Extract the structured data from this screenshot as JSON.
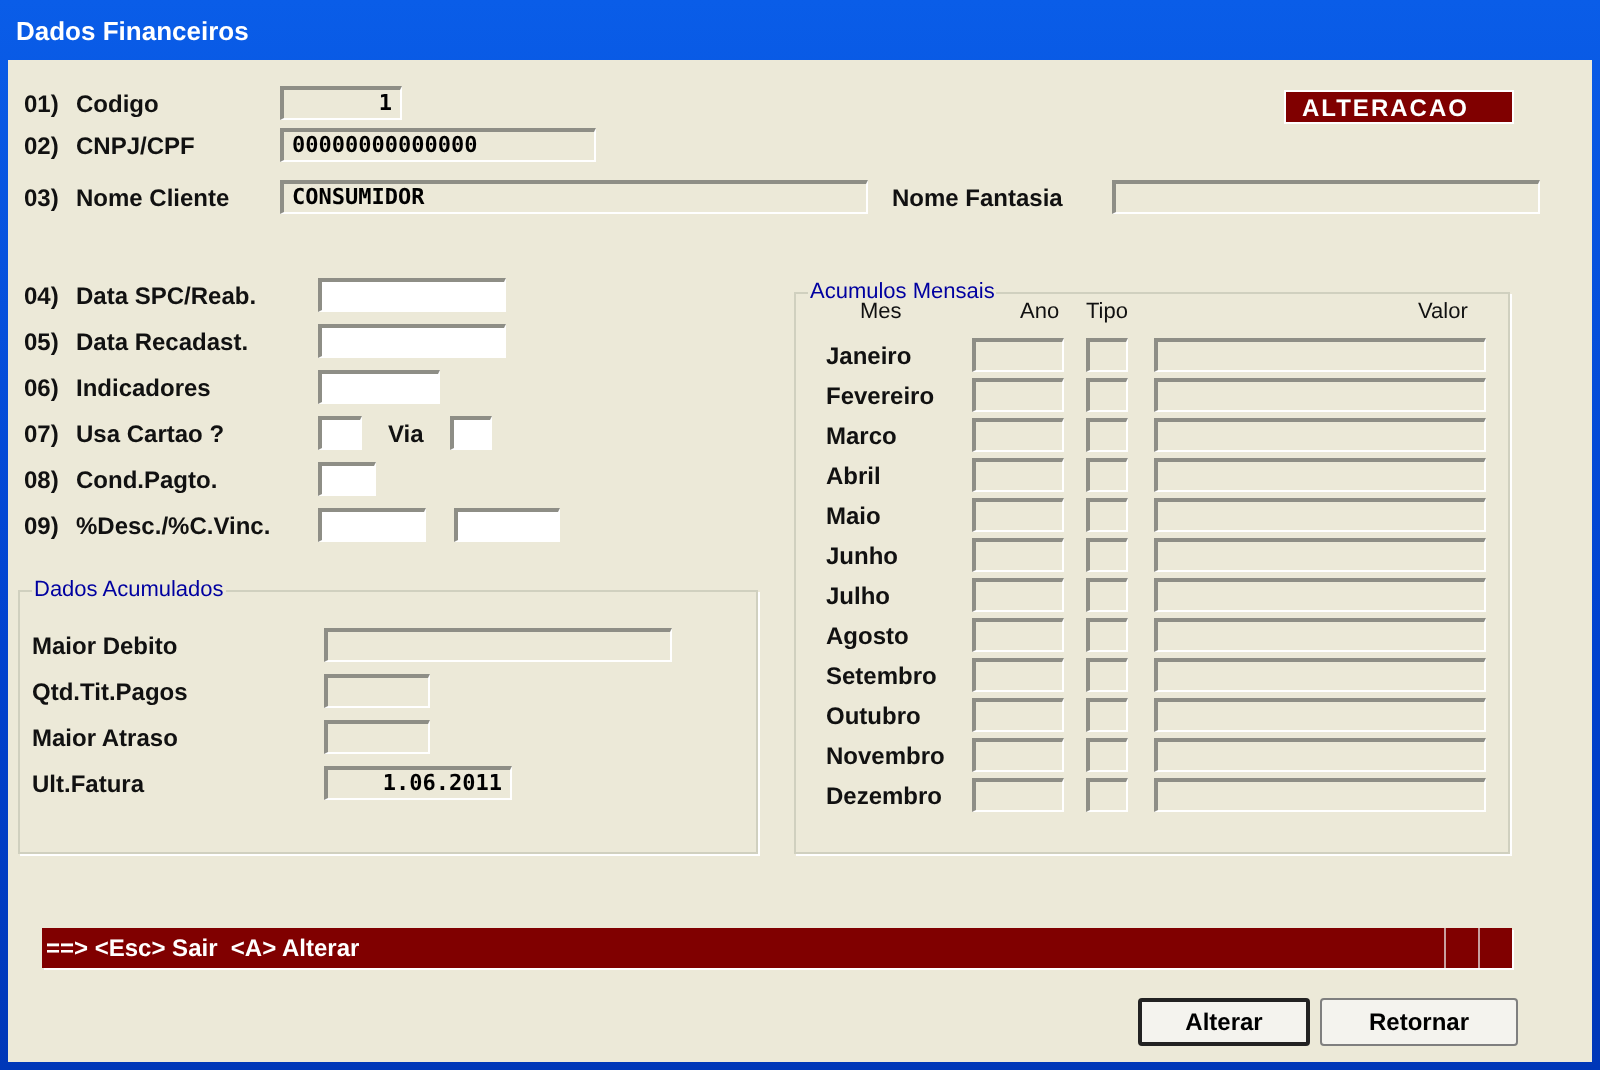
{
  "window": {
    "title": "Dados Financeiros"
  },
  "mode_badge": "ALTERACAO",
  "header_fields": [
    {
      "number": "01)",
      "label": "Codigo",
      "value": "1",
      "kind": "code"
    },
    {
      "number": "02)",
      "label": "CNPJ/CPF",
      "value": "00000000000000",
      "kind": "doc"
    },
    {
      "number": "03)",
      "label": "Nome Cliente",
      "value": "CONSUMIDOR",
      "kind": "name",
      "extra_label": "Nome Fantasia"
    }
  ],
  "form_rows": [
    {
      "number": "04)",
      "label": "Data SPC/Reab.",
      "kind": "date"
    },
    {
      "number": "05)",
      "label": "Data Recadast.",
      "kind": "date"
    },
    {
      "number": "06)",
      "label": "Indicadores",
      "kind": "medium"
    },
    {
      "number": "07)",
      "label": "Usa Cartao ?",
      "kind": "with_via",
      "extra_label": "Via"
    },
    {
      "number": "08)",
      "label": "Cond.Pagto.",
      "kind": "small"
    },
    {
      "number": "09)",
      "label": "%Desc./%C.Vinc.",
      "kind": "pair"
    }
  ],
  "dados_acumulados": {
    "title": "Dados Acumulados",
    "rows": [
      {
        "label": "Maior Debito",
        "kind": "wide"
      },
      {
        "label": "Qtd.Tit.Pagos",
        "kind": "short"
      },
      {
        "label": "Maior Atraso",
        "kind": "short"
      },
      {
        "label": "Ult.Fatura",
        "kind": "date",
        "value": "1.06.2011"
      }
    ]
  },
  "acumulos_mensais": {
    "title": "Acumulos Mensais",
    "columns": [
      "Mes",
      "Ano",
      "Tipo",
      "Valor"
    ],
    "months": [
      "Janeiro",
      "Fevereiro",
      "Marco",
      "Abril",
      "Maio",
      "Junho",
      "Julho",
      "Agosto",
      "Setembro",
      "Outubro",
      "Novembro",
      "Dezembro"
    ]
  },
  "status_bar": "==> <Esc> Sair  <A> Alterar",
  "buttons": [
    {
      "label": "Alterar",
      "default": true
    },
    {
      "label": "Retornar",
      "default": false
    }
  ]
}
